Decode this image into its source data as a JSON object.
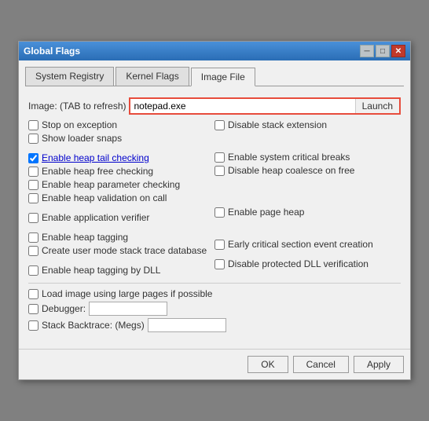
{
  "window": {
    "title": "Global Flags",
    "close_label": "✕",
    "min_label": "─",
    "max_label": "□"
  },
  "tabs": [
    {
      "id": "system-registry",
      "label": "System Registry",
      "active": false
    },
    {
      "id": "kernel-flags",
      "label": "Kernel Flags",
      "active": false
    },
    {
      "id": "image-file",
      "label": "Image File",
      "active": true
    }
  ],
  "image_file": {
    "image_label": "Image: (TAB to refresh)",
    "image_value": "notepad.exe",
    "launch_label": "Launch",
    "left_checkboxes": [
      {
        "id": "stop-exception",
        "label": "Stop on exception",
        "checked": false
      },
      {
        "id": "show-loader",
        "label": "Show loader snaps",
        "checked": false
      },
      {
        "spacer": true
      },
      {
        "id": "enable-heap-tail",
        "label": "Enable heap tail checking",
        "checked": true,
        "underline": true
      },
      {
        "id": "enable-heap-free",
        "label": "Enable heap free checking",
        "checked": false
      },
      {
        "id": "enable-heap-param",
        "label": "Enable heap parameter checking",
        "checked": false
      },
      {
        "id": "enable-heap-val",
        "label": "Enable heap validation on call",
        "checked": false
      },
      {
        "spacer": true
      },
      {
        "id": "enable-app-verifier",
        "label": "Enable application verifier",
        "checked": false
      },
      {
        "spacer": true
      },
      {
        "id": "enable-heap-tag",
        "label": "Enable heap tagging",
        "checked": false
      },
      {
        "id": "create-stack-trace",
        "label": "Create user mode stack trace database",
        "checked": false
      },
      {
        "spacer": true
      },
      {
        "id": "enable-heap-tag-dll",
        "label": "Enable heap tagging by DLL",
        "checked": false
      }
    ],
    "right_checkboxes": [
      {
        "id": "disable-stack-ext",
        "label": "Disable stack extension",
        "checked": false
      },
      {
        "spacer": true
      },
      {
        "spacer": true
      },
      {
        "id": "enable-sys-critical",
        "label": "Enable system critical breaks",
        "checked": false
      },
      {
        "id": "disable-heap-coalesce",
        "label": "Disable heap coalesce on free",
        "checked": false
      },
      {
        "spacer": true
      },
      {
        "spacer": true
      },
      {
        "spacer": true
      },
      {
        "id": "enable-page-heap",
        "label": "Enable page heap",
        "checked": false
      },
      {
        "spacer": true
      },
      {
        "spacer": true
      },
      {
        "id": "early-critical-section",
        "label": "Early critical section event creation",
        "checked": false
      },
      {
        "spacer": true
      },
      {
        "id": "disable-protected-dll",
        "label": "Disable protected DLL verification",
        "checked": false
      }
    ],
    "bottom_section": [
      {
        "id": "load-large-pages",
        "label": "Load image using large pages if possible",
        "checked": false
      }
    ],
    "input_rows": [
      {
        "id": "debugger",
        "label": "Debugger:",
        "value": ""
      },
      {
        "id": "stack-backtrace",
        "label": "Stack Backtrace: (Megs)",
        "value": ""
      }
    ],
    "buttons": {
      "ok": "OK",
      "cancel": "Cancel",
      "apply": "Apply"
    }
  }
}
